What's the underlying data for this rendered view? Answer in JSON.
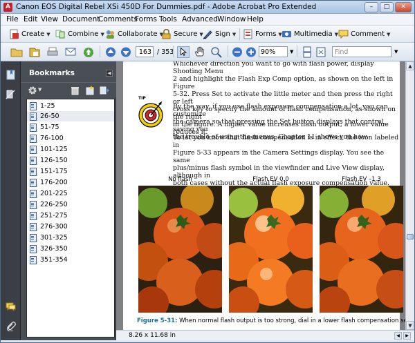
{
  "window": {
    "title": "Canon EOS Digital Rebel XSi 450D For Dummies.pdf - Adobe Acrobat Pro Extended",
    "app_icon_glyph": "A"
  },
  "menu": [
    "File",
    "Edit",
    "View",
    "Document",
    "Comments",
    "Forms",
    "Tools",
    "Advanced",
    "Window",
    "Help"
  ],
  "toolbar": {
    "create": "Create",
    "combine": "Combine",
    "collaborate": "Collaborate",
    "secure": "Secure",
    "sign": "Sign",
    "forms": "Forms",
    "multimedia": "Multimedia",
    "comment": "Comment"
  },
  "navigation": {
    "current_page": "163",
    "total_pages": "/ 353",
    "zoom": "90%",
    "find_placeholder": "Find"
  },
  "bookmarks": {
    "title": "Bookmarks",
    "items": [
      "1-25",
      "26-50",
      "51-75",
      "76-100",
      "101-125",
      "126-150",
      "151-175",
      "176-200",
      "201-225",
      "226-250",
      "251-275",
      "276-300",
      "301-325",
      "326-350",
      "351-354"
    ],
    "selected_index": 1
  },
  "document": {
    "para1": [
      "Whichever direction you want to go with flash power, display Shooting Menu",
      "2 and highlight the Flash Exp Comp option, as shown on the left in Figure",
      "5-32. Press Set to activate the little meter and then press the right or left",
      "cross key to specify the amount of flash compensation, as shown on the right",
      "in the figure. A higher value increases flash output; a lower value reduces it."
    ],
    "para2": [
      "By the way, if you use flash exposure compensation a lot, you can customize",
      "the camera so that pressing the Set button displays that control, saving you",
      "the trouble of using the menus. Chapter 11 shows you how."
    ],
    "para3": [
      "To let you know that flash compensation is in effect, the icon labeled in",
      "Figure 5-33 appears in the Camera Settings display. You see the same",
      "plus/minus flash symbol in the viewfinder and Live View display, although in",
      "both cases without the actual flash exposure compensation value."
    ],
    "tip_label": "TIP",
    "photo_labels": [
      "No flash",
      "Flash EV 0.0",
      "Flash EV –1.3"
    ],
    "caption_fig": "Figure 5-31:",
    "caption_text": "When normal flash output is too strong, dial in a lower flash compensation setting."
  },
  "status": {
    "page_size": "8.26 x 11.68 in"
  }
}
